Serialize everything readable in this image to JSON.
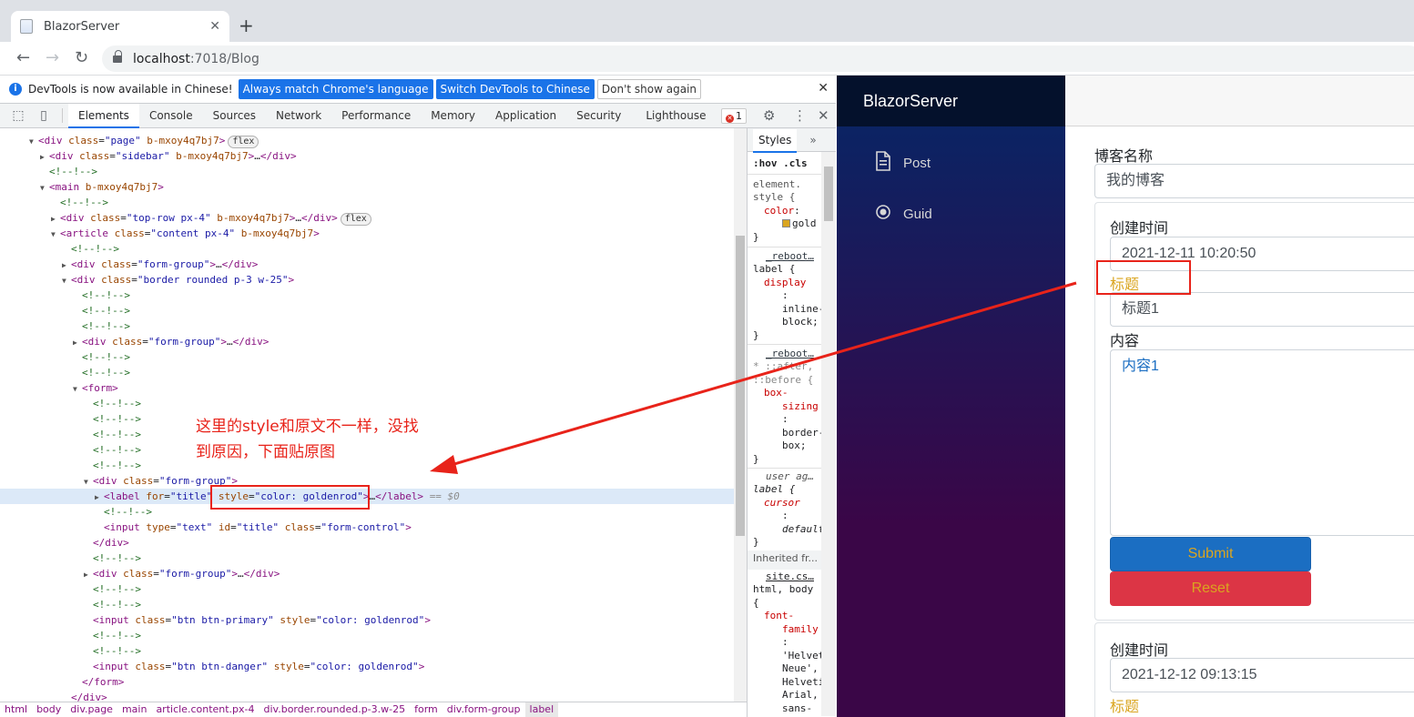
{
  "browser": {
    "tab_title": "BlazorServer",
    "url_host": "localhost",
    "url_rest": ":7018/Blog"
  },
  "devtools": {
    "infobar": {
      "message": "DevTools is now available in Chinese!",
      "btn_match": "Always match Chrome's language",
      "btn_switch": "Switch DevTools to Chinese",
      "btn_dont": "Don't show again"
    },
    "tabs": [
      "Elements",
      "Console",
      "Sources",
      "Network",
      "Performance",
      "Memory",
      "Application",
      "Security",
      "Lighthouse"
    ],
    "error_count": "1",
    "styles_tab": "Styles",
    "styles_filter": ":hov .cls",
    "inherited_label": "Inherited fr...",
    "breadcrumbs": [
      "html",
      "body",
      "div.page",
      "main",
      "article.content.px-4",
      "div.border.rounded.p-3.w-25",
      "form",
      "div.form-group",
      "label"
    ]
  },
  "annotation": {
    "note_line1": "这里的style和原文不一样，没找",
    "note_line2": "到原因，下面贴原图"
  },
  "app": {
    "brand": "BlazorServer",
    "nav": [
      "Post",
      "Guid"
    ],
    "blog_name_label": "博客名称",
    "blog_name_value": "我的博客",
    "created_label": "创建时间",
    "created_value_1": "2021-12-11 10:20:50",
    "title_label": "标题",
    "title_value_1": "标题1",
    "content_label": "内容",
    "content_value_1": "内容1",
    "submit_label": "Submit",
    "reset_label": "Reset",
    "created_value_2": "2021-12-12 09:13:15"
  },
  "colors": {
    "gold": "#daa520",
    "annotation_red": "#e8231a",
    "devtools_blue": "#1a73e8"
  }
}
